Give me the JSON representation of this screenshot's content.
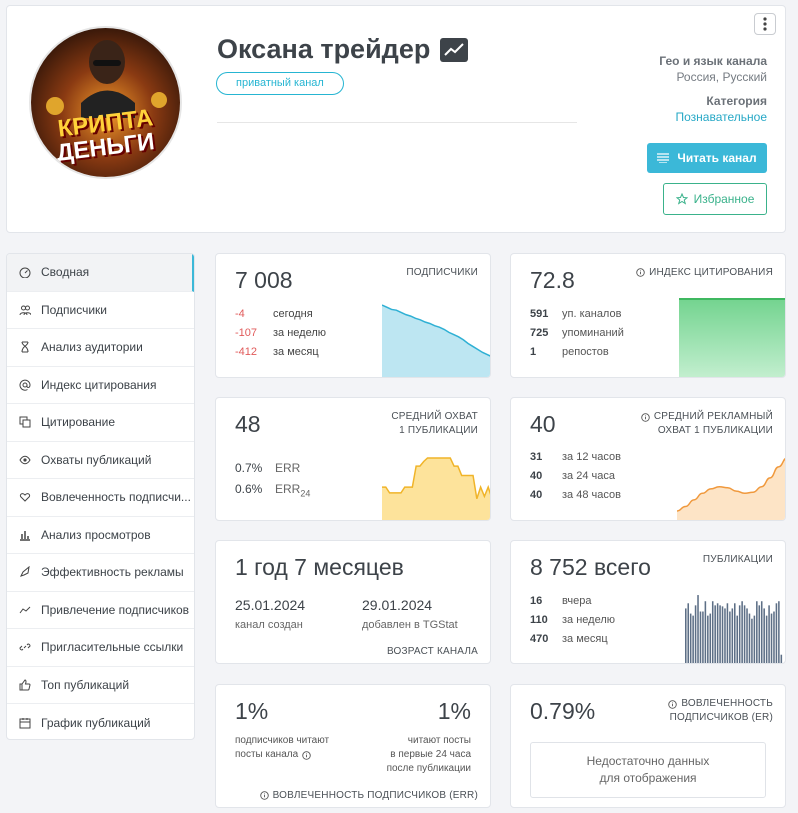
{
  "channel": {
    "title": "Оксана трейдер",
    "badge": "приватный канал",
    "avatar_text_1": "КРИПТА",
    "avatar_text_2": "ДЕНЬГИ",
    "geo_label": "Гео и язык канала",
    "geo_value": "Россия, Русский",
    "category_label": "Категория",
    "category_value": "Познавательное",
    "read_button": "Читать канал",
    "fav_button": "Избранное"
  },
  "sidebar": {
    "items": [
      {
        "label": "Сводная",
        "icon": "gauge-icon"
      },
      {
        "label": "Подписчики",
        "icon": "users-icon"
      },
      {
        "label": "Анализ аудитории",
        "icon": "hourglass-icon"
      },
      {
        "label": "Индекс цитирования",
        "icon": "at-icon"
      },
      {
        "label": "Цитирование",
        "icon": "quote-icon"
      },
      {
        "label": "Охваты публикаций",
        "icon": "eye-icon"
      },
      {
        "label": "Вовлеченность подписчи...",
        "icon": "heart-hand-icon"
      },
      {
        "label": "Анализ просмотров",
        "icon": "bar-chart-icon"
      },
      {
        "label": "Эффективность рекламы",
        "icon": "rocket-icon"
      },
      {
        "label": "Привлечение подписчиков",
        "icon": "trend-icon"
      },
      {
        "label": "Пригласительные ссылки",
        "icon": "link-icon"
      },
      {
        "label": "Топ публикаций",
        "icon": "thumbs-up-icon"
      },
      {
        "label": "График публикаций",
        "icon": "calendar-icon"
      }
    ]
  },
  "subscribers": {
    "value": "7 008",
    "label": "ПОДПИСЧИКИ",
    "rows": [
      {
        "v": "-4",
        "t": "сегодня"
      },
      {
        "v": "-107",
        "t": "за неделю"
      },
      {
        "v": "-412",
        "t": "за месяц"
      }
    ],
    "trend": [
      100,
      97,
      94,
      93,
      90,
      87,
      85,
      82,
      80,
      77,
      75,
      72,
      70,
      67,
      63,
      60,
      57,
      53,
      48,
      44,
      40,
      36,
      33,
      30
    ]
  },
  "citation": {
    "value": "72.8",
    "label": "ИНДЕКС ЦИТИРОВАНИЯ",
    "rows": [
      {
        "v": "591",
        "t": "уп. каналов"
      },
      {
        "v": "725",
        "t": "упоминаний"
      },
      {
        "v": "1",
        "t": "репостов"
      }
    ]
  },
  "reach": {
    "value": "48",
    "label_1": "СРЕДНИЙ ОХВАТ",
    "label_2": "1 ПУБЛИКАЦИИ",
    "rows": [
      {
        "v": "0.7%",
        "t": "ERR"
      },
      {
        "v": "0.6%",
        "t": "ERR",
        "sub": "24"
      }
    ],
    "trend": [
      30,
      30,
      25,
      25,
      25,
      25,
      30,
      30,
      30,
      48,
      48,
      52,
      55,
      55,
      55,
      55,
      55,
      55,
      55,
      48,
      48,
      40,
      40,
      40,
      40,
      20,
      30,
      22,
      30,
      20
    ]
  },
  "ad_reach": {
    "value": "40",
    "label_1": "СРЕДНИЙ РЕКЛАМНЫЙ",
    "label_2": "ОХВАТ 1 ПУБЛИКАЦИИ",
    "rows": [
      {
        "v": "31",
        "t": "за 12 часов"
      },
      {
        "v": "40",
        "t": "за 24 часа"
      },
      {
        "v": "40",
        "t": "за 48 часов"
      }
    ],
    "trend": [
      10,
      14,
      20,
      26,
      30,
      32,
      31,
      28,
      26,
      27,
      32,
      40,
      50,
      58
    ]
  },
  "age": {
    "value": "1 год 7 месяцев",
    "created_date": "25.01.2024",
    "created_label": "канал создан",
    "added_date": "29.01.2024",
    "added_label": "добавлен в TGStat",
    "label": "ВОЗРАСТ КАНАЛА"
  },
  "posts": {
    "value": "8 752",
    "value_suffix": "всего",
    "label": "ПУБЛИКАЦИИ",
    "rows": [
      {
        "v": "16",
        "t": "вчера"
      },
      {
        "v": "110",
        "t": "за неделю"
      },
      {
        "v": "470",
        "t": "за месяц"
      }
    ],
    "bars": [
      55,
      60,
      50,
      48,
      58,
      68,
      52,
      52,
      62,
      48,
      50,
      62,
      58,
      60,
      58,
      57,
      55,
      60,
      52,
      55,
      60,
      48,
      58,
      62,
      58,
      55,
      50,
      45,
      48,
      62,
      58,
      62,
      55,
      48,
      58,
      50,
      52,
      60,
      62,
      10
    ]
  },
  "er_subs": {
    "left_value": "1%",
    "left_text_1": "подписчиков читают",
    "left_text_2": "посты канала",
    "right_value": "1%",
    "right_text_1": "читают посты",
    "right_text_2": "в первые 24 часа",
    "right_text_3": "после публикации",
    "label": "ВОВЛЕЧЕННОСТЬ ПОДПИСЧИКОВ (ERR)"
  },
  "er": {
    "value": "0.79%",
    "label_1": "ВОВЛЕЧЕННОСТЬ",
    "label_2": "ПОДПИСЧИКОВ (ER)",
    "empty_1": "Недостаточно данных",
    "empty_2": "для отображения"
  },
  "colors": {
    "accent": "#3bb8d8",
    "green": "#3ab28b",
    "negative": "#e05a5a",
    "sub_fill": "#bde6f2",
    "cit_fill": "#7fd89a",
    "reach_fill": "#fde39b",
    "ad_line": "#f0993d",
    "bar": "#5d6f86"
  }
}
